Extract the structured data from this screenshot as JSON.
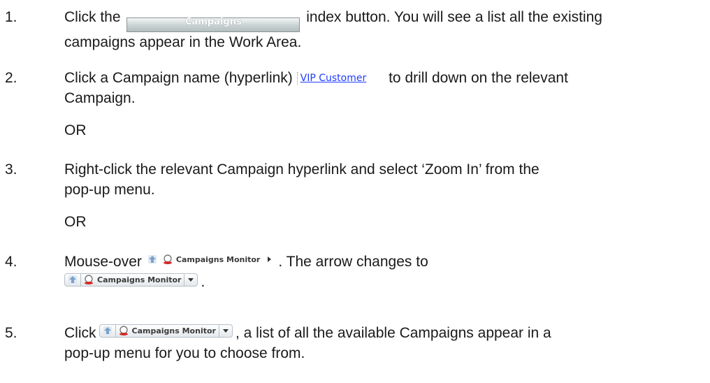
{
  "steps": [
    {
      "number": "1.",
      "before_button": "Click the",
      "button_label": "Campaigns",
      "after_button": "index button. You will see a list all the existing",
      "line2": "campaigns appear in the Work Area."
    },
    {
      "number": "2.",
      "before_link": "Click a Campaign name (hyperlink)",
      "link_label": "VIP Customer",
      "after_link": "to drill down on the relevant",
      "line2": "Campaign."
    },
    {
      "number": "3.",
      "line1": "Right-click the relevant Campaign hyperlink and select ‘Zoom In’ from the",
      "line2": "pop-up menu."
    },
    {
      "number": "4.",
      "before_widget": "Mouse-over",
      "widget_label": "Campaigns Monitor",
      "after_widget": ". The arrow changes to",
      "line2_suffix": "."
    },
    {
      "number": "5.",
      "before_widget": "Click",
      "widget_label": "Campaigns Monitor",
      "after_widget": ", a list of all the available Campaigns appear in a",
      "line2": "pop-up menu for you to choose from."
    }
  ],
  "or_label": "OR",
  "colors": {
    "text": "#1a1a1a",
    "link": "#1e3cff",
    "button_gradient_top": "#f4f6f6",
    "button_gradient_bottom": "#b3bebe"
  },
  "icons": [
    "home-arrow-icon",
    "campaign-monitor-icon",
    "chevron-right-icon",
    "chevron-down-icon"
  ]
}
